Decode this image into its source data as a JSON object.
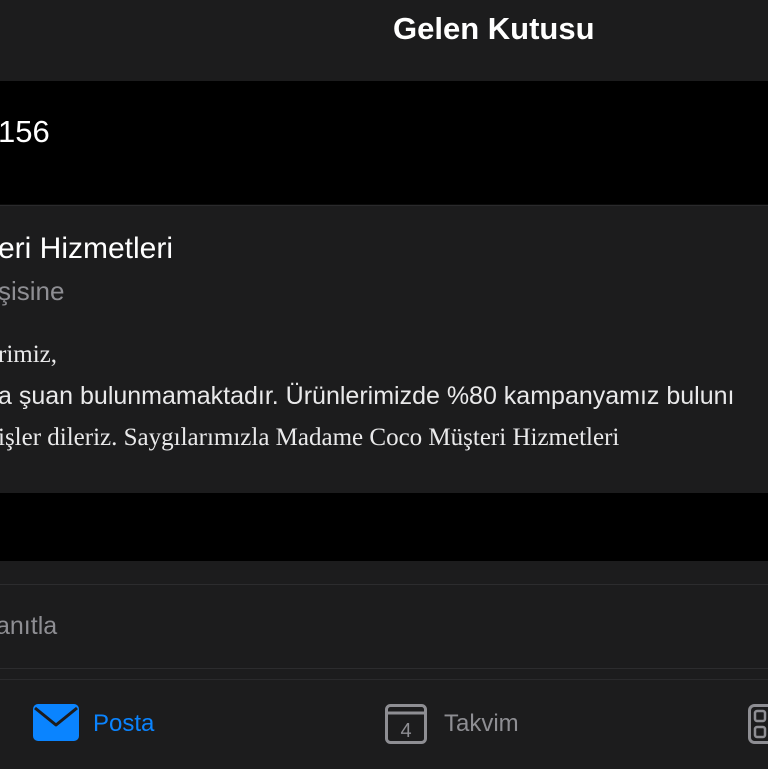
{
  "header": {
    "title": "Gelen Kutusu"
  },
  "subject": {
    "text": "156"
  },
  "message": {
    "sender": "eri Hizmetleri",
    "recipient": "şisine",
    "body_lines": [
      "rimiz,",
      "a  şuan  bulunmamaktadır. Ürünlerimizde %80 kampanyamız bulunı",
      "işler dileriz. Saygılarımızla Madame Coco Müşteri Hizmetleri"
    ]
  },
  "actions": {
    "reply_label": "anıtla"
  },
  "tabbar": {
    "tabs": [
      {
        "label": "Posta",
        "icon": "mail-icon",
        "active": true
      },
      {
        "label": "Takvim",
        "icon": "calendar-icon",
        "badge": "4",
        "active": false
      },
      {
        "label": "",
        "icon": "apps-grid-icon",
        "active": false
      }
    ]
  },
  "colors": {
    "accent": "#0a84ff",
    "background": "#000000",
    "surface": "#1c1c1d",
    "muted_text": "#8e8e93"
  }
}
